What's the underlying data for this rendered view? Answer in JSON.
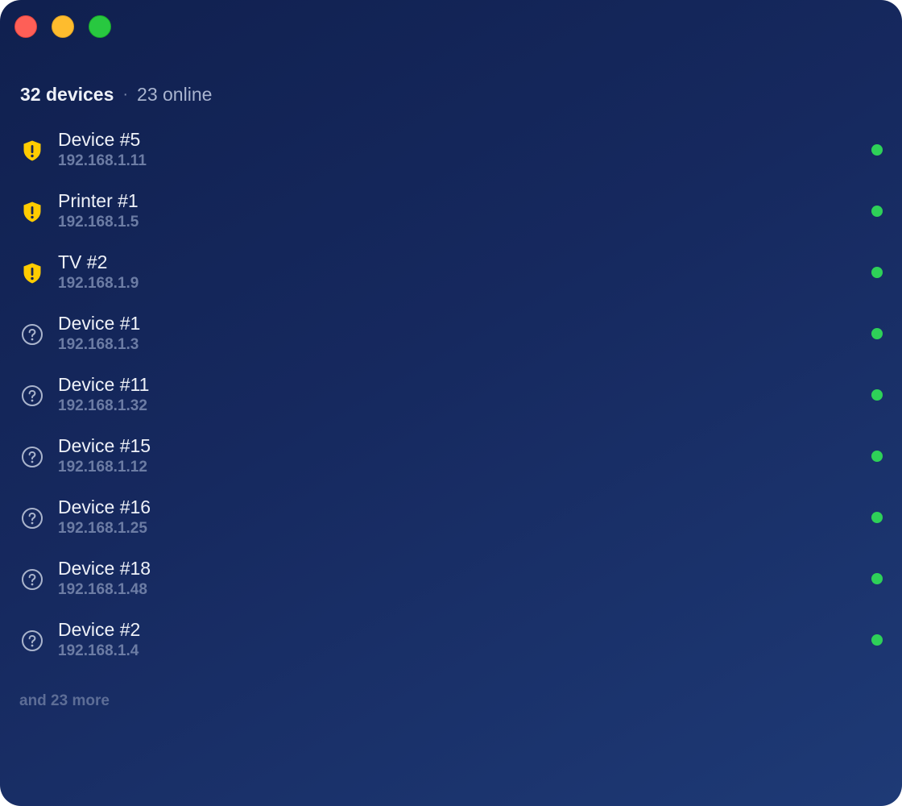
{
  "summary": {
    "device_count": "32 devices",
    "separator": "·",
    "online_count": "23 online"
  },
  "colors": {
    "warning": "#ffcc00",
    "online": "#2ed158",
    "unknown": "#aab4cc"
  },
  "devices": [
    {
      "name": "Device #5",
      "ip": "192.168.1.11",
      "icon": "shield-warning-icon",
      "status": "online"
    },
    {
      "name": "Printer #1",
      "ip": "192.168.1.5",
      "icon": "shield-warning-icon",
      "status": "online"
    },
    {
      "name": "TV #2",
      "ip": "192.168.1.9",
      "icon": "shield-warning-icon",
      "status": "online"
    },
    {
      "name": "Device #1",
      "ip": "192.168.1.3",
      "icon": "question-circle-icon",
      "status": "online"
    },
    {
      "name": "Device #11",
      "ip": "192.168.1.32",
      "icon": "question-circle-icon",
      "status": "online"
    },
    {
      "name": "Device #15",
      "ip": "192.168.1.12",
      "icon": "question-circle-icon",
      "status": "online"
    },
    {
      "name": "Device #16",
      "ip": "192.168.1.25",
      "icon": "question-circle-icon",
      "status": "online"
    },
    {
      "name": "Device #18",
      "ip": "192.168.1.48",
      "icon": "question-circle-icon",
      "status": "online"
    },
    {
      "name": "Device #2",
      "ip": "192.168.1.4",
      "icon": "question-circle-icon",
      "status": "online"
    }
  ],
  "more_label": "and 23 more"
}
